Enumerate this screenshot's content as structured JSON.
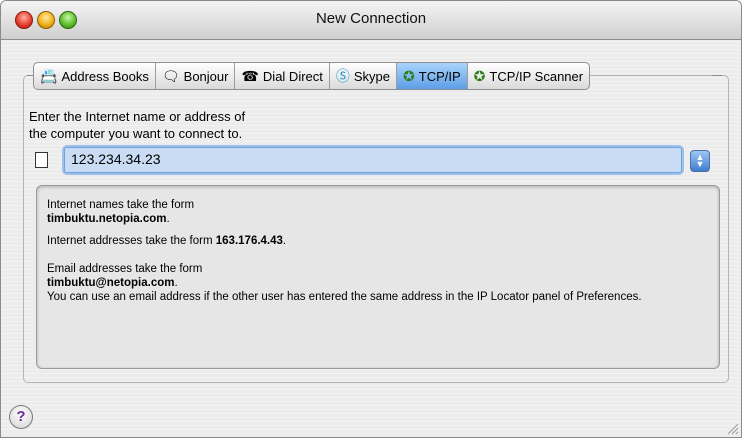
{
  "window": {
    "title": "New Connection"
  },
  "tabs": [
    {
      "label": "Address Books",
      "icon": "address-book-icon",
      "glyph": "📇"
    },
    {
      "label": "Bonjour",
      "icon": "bonjour-icon",
      "glyph": "🗨"
    },
    {
      "label": "Dial Direct",
      "icon": "telephone-icon",
      "glyph": "☎"
    },
    {
      "label": "Skype",
      "icon": "skype-icon",
      "glyph": "Ⓢ"
    },
    {
      "label": "TCP/IP",
      "icon": "network-icon",
      "glyph": "✪",
      "active": true
    },
    {
      "label": "TCP/IP Scanner",
      "icon": "network-scanner-icon",
      "glyph": "✪"
    }
  ],
  "prompt": {
    "line1": "Enter the Internet name or address of",
    "line2": "the computer you want to connect to."
  },
  "address_field": {
    "value": "123.234.34.23"
  },
  "info": {
    "names_text": "Internet names take the form",
    "names_example": "timbuktu.netopia.com",
    "addresses_text": "Internet addresses take the form",
    "addresses_example": "163.176.4.43",
    "email_text": "Email addresses take the form",
    "email_example": "timbuktu@netopia.com",
    "email_note": "You can use an email address if the other user has entered the same address in the IP Locator panel of Preferences."
  },
  "colors": {
    "active_tab": "#5d9ee6",
    "field_focus": "#9ec0ea"
  }
}
